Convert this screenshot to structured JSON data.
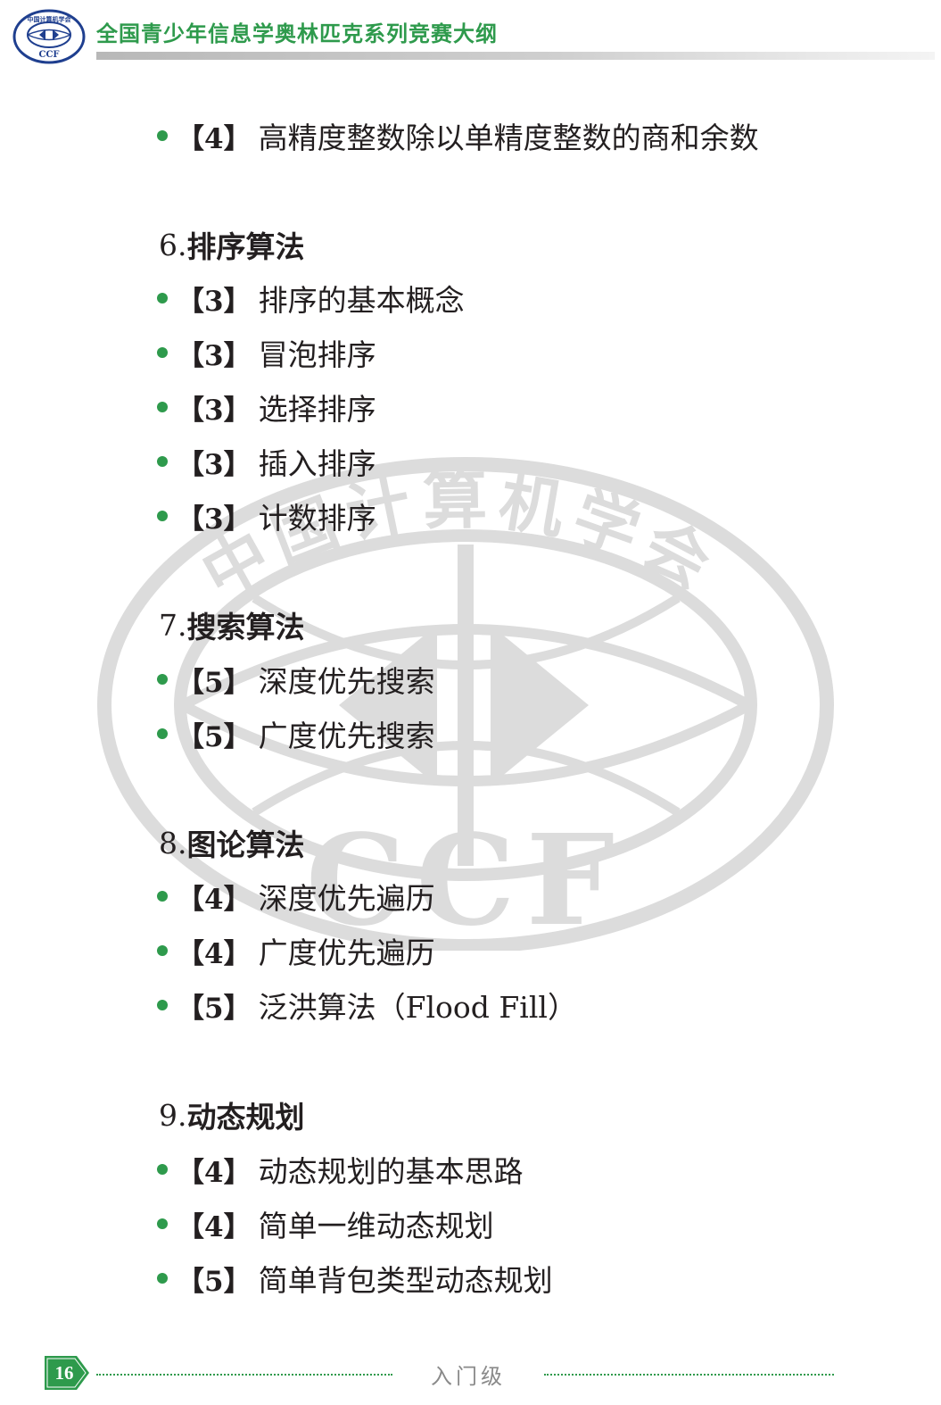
{
  "header": {
    "title": "全国青少年信息学奥林匹克系列竞赛大纲",
    "logo_text": "中国计算机学会",
    "logo_abbr": "CCF"
  },
  "colors": {
    "accent": "#2e9a4c",
    "text": "#231f20",
    "watermark": "#dcdcdc"
  },
  "icons": {
    "bullet": "green-dot-icon",
    "logo": "ccf-logo-icon",
    "page_badge": "page-arrow-badge-icon"
  },
  "items_top": [
    {
      "level": "【4】",
      "text": "高精度整数除以单精度整数的商和余数"
    }
  ],
  "sections": [
    {
      "number": "6.",
      "title": "排序算法",
      "items": [
        {
          "level": "【3】",
          "text": "排序的基本概念"
        },
        {
          "level": "【3】",
          "text": "冒泡排序"
        },
        {
          "level": "【3】",
          "text": "选择排序"
        },
        {
          "level": "【3】",
          "text": "插入排序"
        },
        {
          "level": "【3】",
          "text": "计数排序"
        }
      ]
    },
    {
      "number": "7.",
      "title": "搜索算法",
      "items": [
        {
          "level": "【5】",
          "text": "深度优先搜索"
        },
        {
          "level": "【5】",
          "text": "广度优先搜索"
        }
      ]
    },
    {
      "number": "8.",
      "title": "图论算法",
      "items": [
        {
          "level": "【4】",
          "text": "深度优先遍历"
        },
        {
          "level": "【4】",
          "text": "广度优先遍历"
        },
        {
          "level": "【5】",
          "text": "泛洪算法（Flood Fill）"
        }
      ]
    },
    {
      "number": "9.",
      "title": "动态规划",
      "items": [
        {
          "level": "【4】",
          "text": "动态规划的基本思路"
        },
        {
          "level": "【4】",
          "text": "简单一维动态规划"
        },
        {
          "level": "【5】",
          "text": "简单背包类型动态规划"
        }
      ]
    }
  ],
  "footer": {
    "page_number": "16",
    "label": "入门级"
  }
}
